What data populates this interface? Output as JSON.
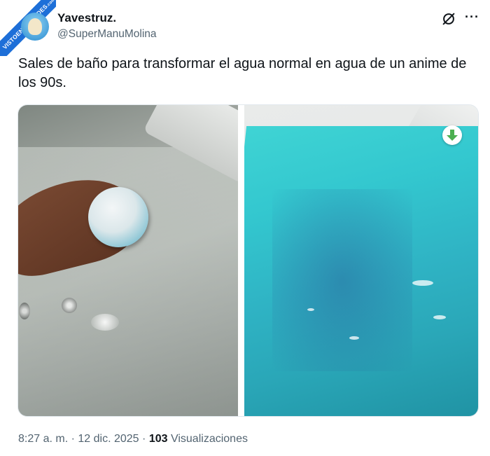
{
  "watermark": {
    "line1": "VISTOENLASREDES",
    "line2": ".com"
  },
  "author": {
    "name": "Yavestruz.",
    "handle": "@SuperManuMolina",
    "avatar_icon": "ostrich-avatar-icon"
  },
  "header_actions": {
    "grok_icon": "grok-icon",
    "more_icon": "more-options-icon",
    "more_label": "···"
  },
  "tweet": {
    "text": "Sales de baño para transformar el agua normal en agua de un anime de los 90s."
  },
  "media": {
    "photos": [
      {
        "description_icon": "bathtub-clear-water-photo"
      },
      {
        "description_icon": "bathtub-blue-water-photo"
      }
    ],
    "download_icon": "download-arrow-icon",
    "colors": {
      "blue_water": "#33c7cf",
      "download_accent": "#4caf50"
    }
  },
  "meta": {
    "time": "8:27 a. m.",
    "separator": "·",
    "date": "12 dic. 2025",
    "views_count": "103",
    "views_label": "Visualizaciones"
  }
}
